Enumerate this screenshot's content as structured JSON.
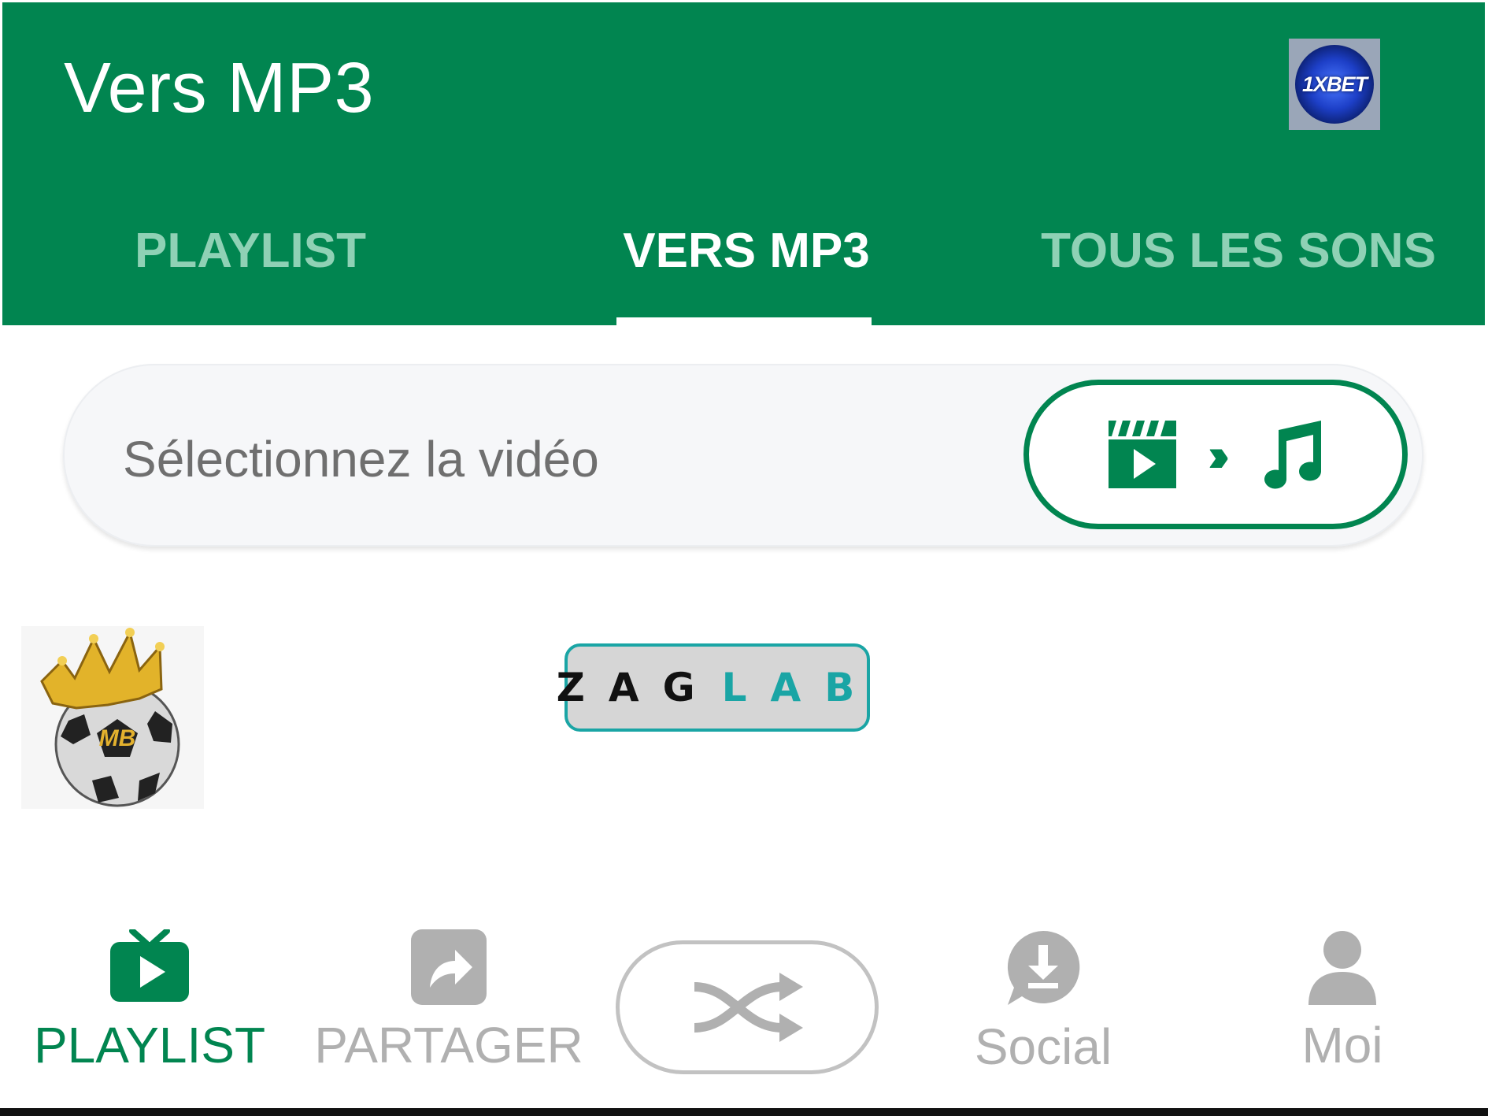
{
  "header": {
    "title": "Vers MP3",
    "ad_badge": "1XBET",
    "background_color": "#018550"
  },
  "tabs": [
    {
      "label": "PLAYLIST",
      "active": false
    },
    {
      "label": "VERS MP3",
      "active": true
    },
    {
      "label": "TOUS LES SONS",
      "active": false
    }
  ],
  "selector": {
    "text": "Sélectionnez la vidéo",
    "convert_icons": [
      "video-clapper-icon",
      "chevrons-right-icon",
      "music-note-icon"
    ],
    "chevrons": "›››"
  },
  "content": {
    "badge_logo": "MB",
    "zaglab_logo": {
      "part1": "ZAG",
      "part2": "LAB"
    }
  },
  "bottom_nav": [
    {
      "label": "PLAYLIST",
      "icon": "tv-play-icon",
      "active": true
    },
    {
      "label": "PARTAGER",
      "icon": "share-icon",
      "active": false
    },
    {
      "label": "",
      "icon": "shuffle-icon",
      "active": false
    },
    {
      "label": "Social",
      "icon": "download-chat-icon",
      "active": false
    },
    {
      "label": "Moi",
      "icon": "person-icon",
      "active": false
    }
  ],
  "colors": {
    "accent": "#018550",
    "inactive": "#b0b0b0",
    "tab_inactive": "#8fd1b5",
    "zaglab": "#1aa5a5"
  }
}
